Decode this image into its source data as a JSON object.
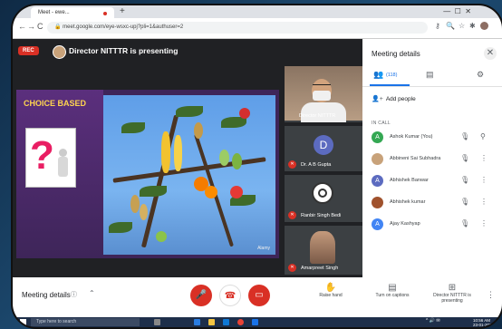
{
  "browser": {
    "tab_title": "Meet - ewe...",
    "new_tab": "+",
    "url": "meet.google.com/eye-wsxc-upj?pli=1&authuser=2"
  },
  "meet": {
    "rec_label": "REC",
    "presenting_text": "Director NITTTR is presenting",
    "slide_title": "CHOICE BASED",
    "slide_watermark": "Alamy",
    "tiles": [
      {
        "name": "Director NITTTR"
      },
      {
        "name": "Dr. A B Gupta",
        "avatar_letter": "D"
      },
      {
        "name": "Ranbir Singh Bedi"
      },
      {
        "name": "Amarpreet Singh"
      }
    ]
  },
  "panel": {
    "title": "Meeting details",
    "people_count": "(118)",
    "add_people": "Add people",
    "in_call_label": "IN CALL",
    "participants": [
      {
        "name": "Ashok Kumar (You)",
        "avatar": "A",
        "color": "#34a853"
      },
      {
        "name": "Abbineni Sai Subhadra",
        "avatar": "",
        "color": "#c8a27a"
      },
      {
        "name": "Abhishek Banwar",
        "avatar": "A",
        "color": "#5c6bc0"
      },
      {
        "name": "Abhishek kumar",
        "avatar": "",
        "color": "#a0522d"
      },
      {
        "name": "Ajay Kashyap",
        "avatar": "A",
        "color": "#4285f4"
      }
    ]
  },
  "bottombar": {
    "meeting_details": "Meeting details",
    "raise_hand": "Raise hand",
    "turn_on_captions": "Turn on captions",
    "presenting": "Director NITTTR is presenting"
  },
  "taskbar": {
    "search_placeholder": "Type here to search",
    "time": "10:56 AM",
    "date": "23-01-2021"
  },
  "colors": {
    "accent": "#1a73e8",
    "danger": "#d93025",
    "slide_bg": "#3e2559",
    "slide_title": "#ffd54f"
  }
}
